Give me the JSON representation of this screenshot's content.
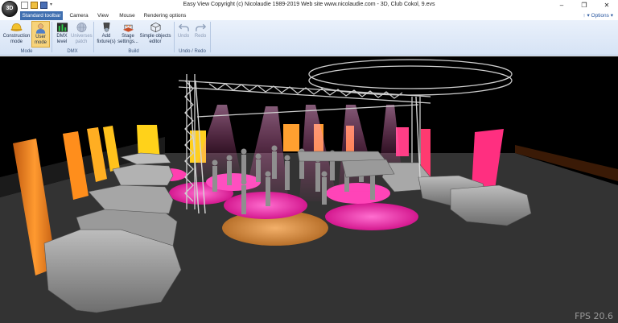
{
  "app": {
    "orb_label": "3D",
    "title": "Easy View   Copyright (c) Nicolaudie 1989-2019   Web site www.nicolaudie.com - 3D, Club Cokol, 9.evs",
    "window_buttons": [
      "–",
      "❐",
      "✕"
    ]
  },
  "quick_access": {
    "icons": [
      "new-file-icon",
      "open-folder-icon",
      "save-icon"
    ],
    "dropdown": "▾"
  },
  "tabs": [
    "Standard toolbar",
    "Camera",
    "View",
    "Mouse",
    "Rendering options"
  ],
  "options_label": "↑ ▾ Options ▾",
  "ribbon": {
    "buttons": [
      {
        "label": "Construction\nmode",
        "icon": "hard-hat-icon"
      },
      {
        "label": "User\nmode",
        "icon": "user-icon",
        "selected": true
      },
      {
        "label": "DMX\nlevel",
        "icon": "dmx-level-icon"
      },
      {
        "label": "Universes\npatch",
        "icon": "globe-icon",
        "disabled": true
      },
      {
        "label": "Add\nfixture(s)",
        "icon": "fixture-icon"
      },
      {
        "label": "Stage\nsettings...",
        "icon": "stage-icon"
      },
      {
        "label": "Simple objects\neditor",
        "icon": "cube-icon"
      },
      {
        "label": "Undo",
        "icon": "undo-icon",
        "disabled": true
      },
      {
        "label": "Redo",
        "icon": "redo-icon",
        "disabled": true
      }
    ],
    "groups": [
      "Mode",
      "DMX",
      "Build",
      "Undo / Redo"
    ]
  },
  "viewport": {
    "fps_text": "FPS 20.6",
    "colors": {
      "orange": "#ff8a1e",
      "amber": "#ffb020",
      "yellow": "#ffd21a",
      "magenta": "#ff2aa8",
      "pink": "#ff2f80",
      "floor": "#3a3a3a"
    }
  }
}
